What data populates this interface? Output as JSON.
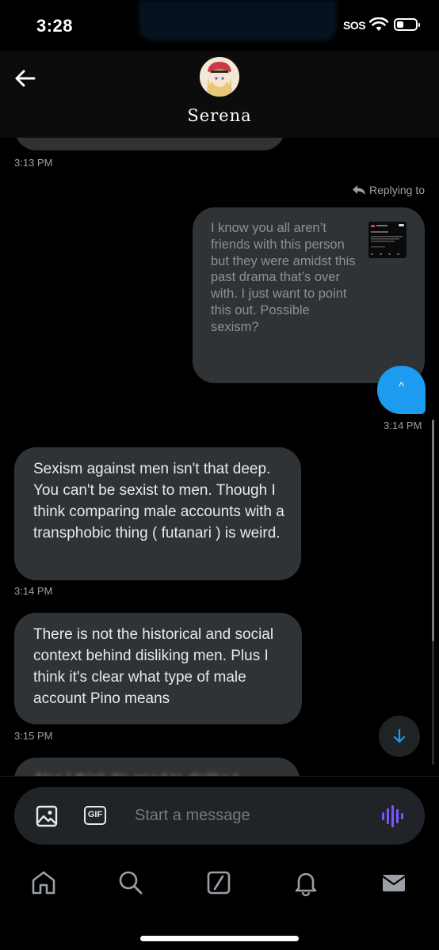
{
  "status_bar": {
    "time": "3:28",
    "sos": "SOS",
    "icons": [
      "wifi-icon",
      "battery-icon"
    ]
  },
  "header": {
    "back_icon": "arrow-left-icon",
    "contact_name": "Serena"
  },
  "conversation": {
    "top_timestamp": "3:13 PM",
    "replying_label": "Replying to",
    "quoted_message": "I know you all aren’t friends with this person but they were amidst this past drama that’s over with. I just want to point this out. Possible sexism?",
    "sent_caret": "^",
    "sent_timestamp": "3:14 PM",
    "messages": [
      {
        "text": "Sexism against men isn't that deep. You can't be sexist to men. Though I think comparing male accounts with a transphobic thing ( futanari ) is weird.",
        "time": "3:14 PM"
      },
      {
        "text": "There is not the historical and social context behind disliking men. Plus I think it's clear what type of male account Pino means",
        "time": "3:15 PM"
      },
      {
        "text": "Also I think it's good to dislike t",
        "time": ""
      }
    ]
  },
  "composer": {
    "placeholder": "Start a message",
    "gif_label": "GIF"
  },
  "bottom_nav": {
    "items": [
      "home-icon",
      "search-icon",
      "grok-icon",
      "notifications-icon",
      "messages-icon"
    ]
  },
  "colors": {
    "background": "#000000",
    "bubble": "#2f3336",
    "accent": "#1d9bf0",
    "voice": "#7856ff"
  }
}
